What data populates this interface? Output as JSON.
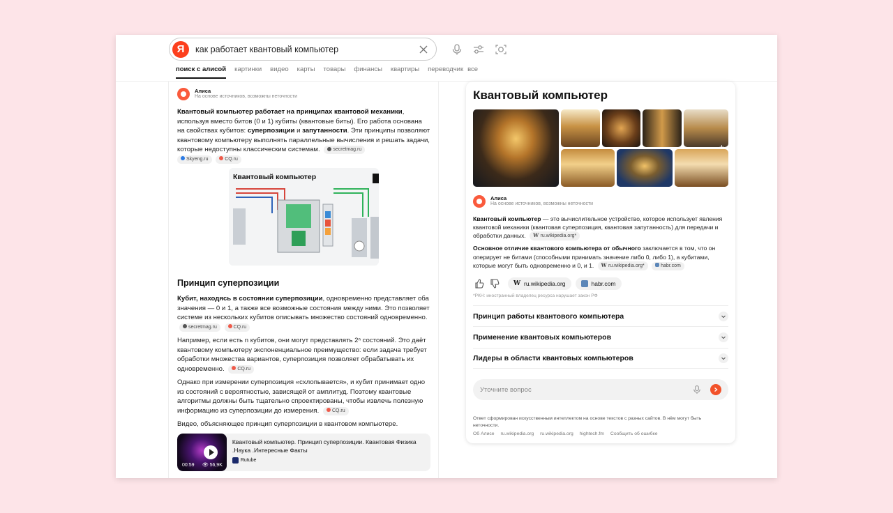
{
  "search": {
    "logo": "Я",
    "query": "как работает квантовый компьютер"
  },
  "tabs": [
    "поиск с алисой",
    "картинки",
    "видео",
    "карты",
    "товары",
    "финансы",
    "квартиры",
    "переводчик",
    "все"
  ],
  "left": {
    "alice_name": "Алиса",
    "alice_sub": "На основе источников, возможны неточности",
    "p1": {
      "b1": "Квантовый компьютер работает на принципах квантовой механики",
      "t1": ", используя вместо битов (0 и 1) кубиты (квантовые биты). Его работа основана на свойствах кубитов: ",
      "b2": "суперпозиции",
      "t2": " и ",
      "b3": "запутанности",
      "t3": ". Эти принципы позволяют квантовому компьютеру выполнять параллельные вычисления и решать задачи, которые недоступны классическим системам."
    },
    "src_secretmag": "secretmag.ru",
    "src_skyeng": "Skyeng.ru",
    "src_cq": "CQ.ru",
    "diagram_title": "Квантовый компьютер",
    "h2": "Принцип суперпозиции",
    "p2_b": "Кубит, находясь в состоянии суперпозиции",
    "p2_t": ", одновременно представляет оба значения — 0 и 1, а также все возможные состояния между ними. Это позволяет системе из нескольких кубитов описывать множество состояний одновременно.",
    "p3": "Например, если есть n кубитов, они могут представлять 2ⁿ состояний. Это даёт квантовому компьютеру экспоненциальное преимущество: если задача требует обработки множества вариантов, суперпозиция позволяет обрабатывать их одновременно.",
    "p4": "Однако при измерении суперпозиция «схлопывается», и кубит принимает одно из состояний с вероятностью, зависящей от амплитуд. Поэтому квантовые алгоритмы должны быть тщательно спроектированы, чтобы извлечь полезную информацию из суперпозиции до измерения.",
    "p5": "Видео, объясняющее принцип суперпозиции в квантовом компьютере.",
    "video": {
      "title": "Квантовый компьютер. Принцип суперпозиции. Квантовая Физика .Наука .Интересные Факты",
      "duration": "00:59",
      "views": "56,9K",
      "source": "Rutube"
    }
  },
  "right": {
    "title": "Квантовый компьютер",
    "alice_name": "Алиса",
    "alice_sub": "На основе источников, возможны неточности",
    "p1_b": "Квантовый компьютер",
    "p1_t": " — это вычислительное устройство, которое использует явления квантовой механики (квантовая суперпозиция, квантовая запутанность) для передачи и обработки данных.",
    "src_wiki": "ru.wikipedia.org*",
    "p2_b": "Основное отличие квантового компьютера от обычного",
    "p2_t": " заключается в том, что он оперирует не битами (способными принимать значение либо 0, либо 1), а кубитами, которые могут быть одновременно и 0, и 1.",
    "src_habr": "habr.com",
    "pill_wiki": "ru.wikipedia.org",
    "pill_habr": "habr.com",
    "rkn": "*РКН: иностранный владелец ресурса нарушает закон РФ",
    "accordion": [
      "Принцип работы квантового компьютера",
      "Применение квантовых компьютеров",
      "Лидеры в области квантовых компьютеров"
    ],
    "ask_placeholder": "Уточните вопрос",
    "footer": "Ответ сформирован искусственным интеллектом на основе текстов с разных сайтов. В нём могут быть неточности.",
    "footer_links": [
      "Об Алисе",
      "ru.wikipedia.org",
      "ru.wikipedia.org",
      "hightech.fm",
      "Сообщить об ошибке"
    ]
  },
  "colors": {
    "yandex_red": "#fc3f1d",
    "alice_orange": "#fa5a3c",
    "background": "#fde4e8"
  }
}
